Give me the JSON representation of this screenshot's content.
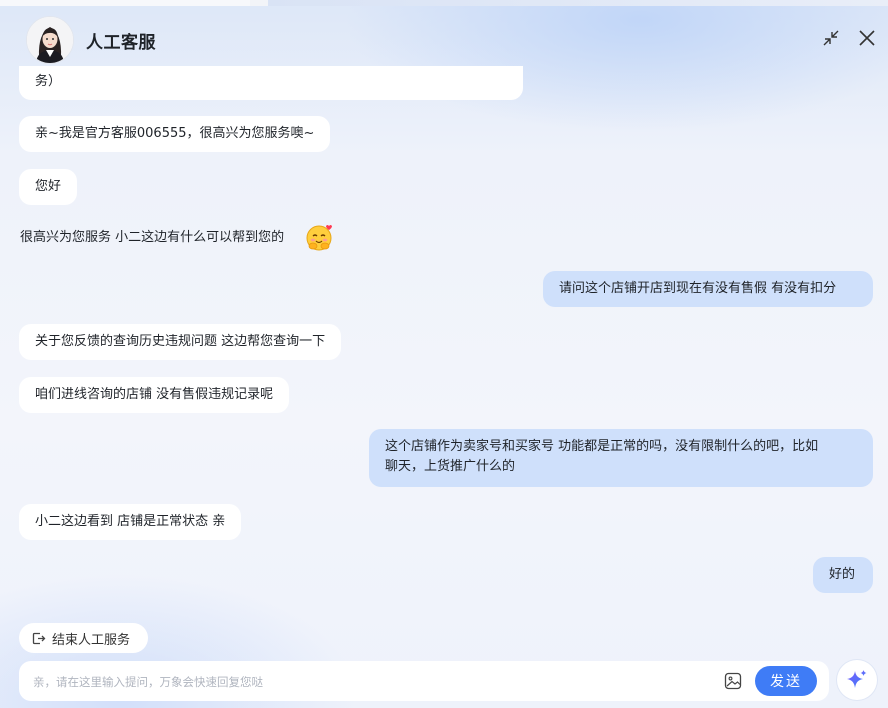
{
  "header": {
    "title": "人工客服"
  },
  "messages": [
    {
      "from": "bot",
      "text": "务）"
    },
    {
      "from": "bot",
      "text": "亲~我是官方客服006555，很高兴为您服务噢~"
    },
    {
      "from": "bot",
      "text": "您好"
    },
    {
      "from": "bot",
      "text": "很高兴为您服务 小二这边有什么可以帮到您的"
    },
    {
      "from": "user",
      "text": "请问这个店铺开店到现在有没有售假 有没有扣分"
    },
    {
      "from": "bot",
      "text": "关于您反馈的查询历史违规问题 这边帮您查询一下"
    },
    {
      "from": "bot",
      "text": "咱们进线咨询的店铺 没有售假违规记录呢"
    },
    {
      "from": "user",
      "lines": [
        "这个店铺作为卖家号和买家号 功能都是正常的吗，没有限制什么的吧，比如",
        "聊天，上货推广什么的"
      ]
    },
    {
      "from": "bot",
      "text": "小二这边看到 店铺是正常状态 亲"
    },
    {
      "from": "user",
      "text": "好的"
    }
  ],
  "footer": {
    "end_service_label": "结束人工服务",
    "input_placeholder": "亲，请在这里输入提问，万象会快速回复您哒",
    "send_label": "发送"
  },
  "colors": {
    "accent": "#3f7cf6",
    "user_bubble": "#cfe0fb",
    "bot_bubble": "#ffffff"
  }
}
